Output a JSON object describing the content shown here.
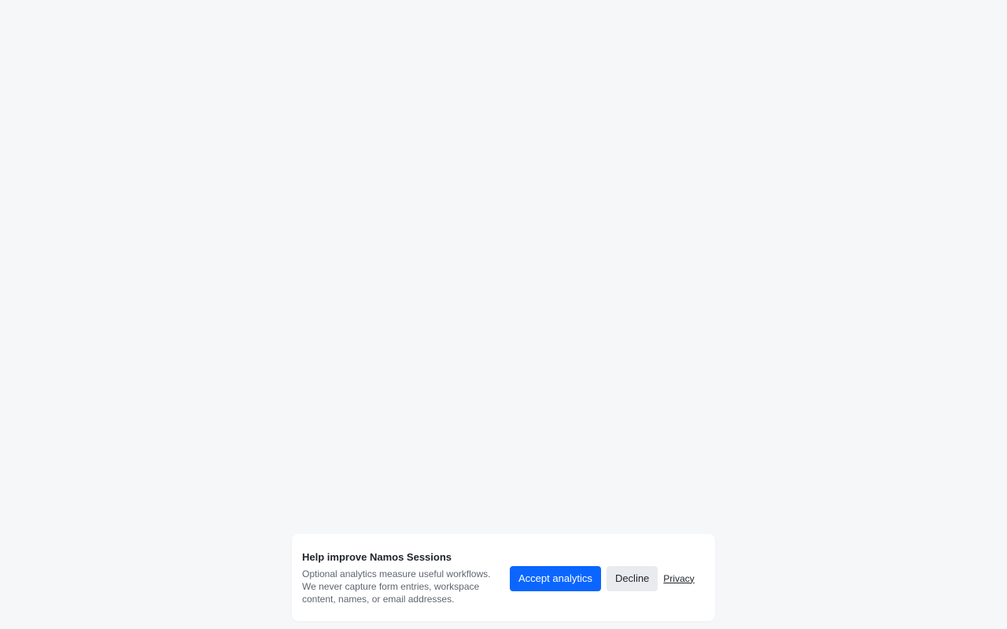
{
  "consent_banner": {
    "title": "Help improve Namos Sessions",
    "description": "Optional analytics measure useful workflows. We never capture form entries, workspace content, names, or email addresses.",
    "accept_label": "Accept analytics",
    "decline_label": "Decline",
    "privacy_label": "Privacy"
  },
  "colors": {
    "background": "#f5f7f9",
    "accent": "#0a66ff",
    "secondary_button": "#e9ebee"
  }
}
